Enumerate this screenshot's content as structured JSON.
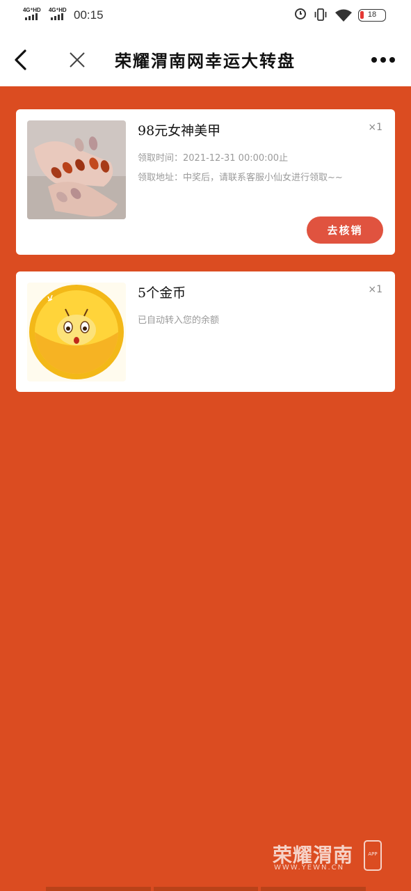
{
  "status_bar": {
    "signal1": "4G⁺HD",
    "signal2": "4G⁺HD",
    "time": "00:15",
    "battery": "18"
  },
  "nav": {
    "title": "荣耀渭南网幸运大转盘",
    "icons": [
      "back-icon",
      "close-icon",
      "more-icon"
    ]
  },
  "prizes": [
    {
      "name": "98元女神美甲",
      "qty": "×1",
      "time_line": "领取时间：2021-12-31 00:00:00止",
      "address_line": "领取地址：中奖后，请联系客服小仙女进行领取~~",
      "button": "去核销",
      "image": "nail-art-photo"
    },
    {
      "name": "5个金币",
      "qty": "×1",
      "note": "已自动转入您的余额",
      "image": "gold-coin-illustration"
    }
  ],
  "watermark": {
    "text": "荣耀渭南",
    "url": "WWW.YEWN.CN",
    "badge": "APP"
  },
  "colors": {
    "background": "#db4c21",
    "button": "#e0533f"
  }
}
